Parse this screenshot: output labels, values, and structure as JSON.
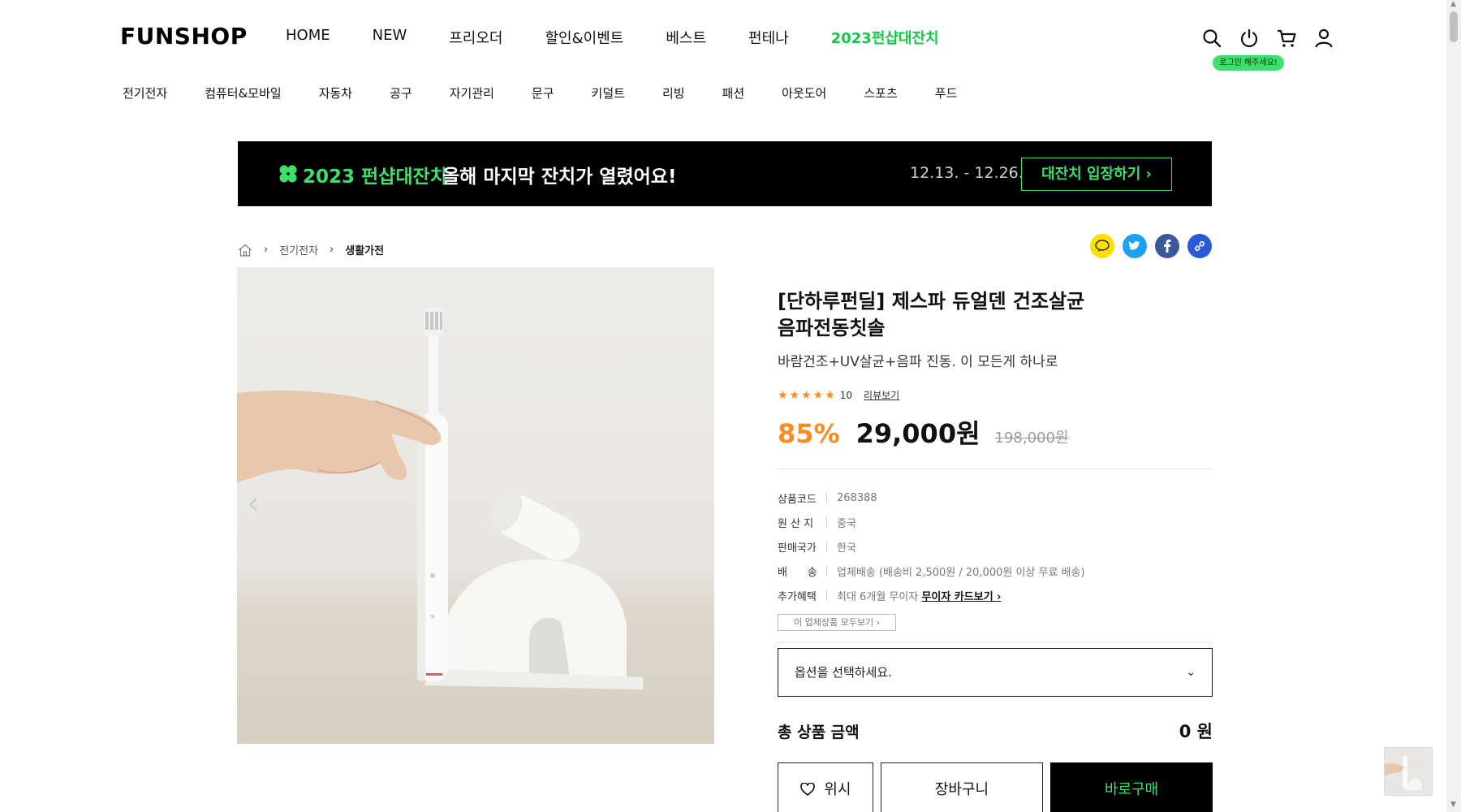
{
  "header": {
    "logo": "FUNSHOP",
    "nav": [
      "HOME",
      "NEW",
      "프리오더",
      "할인&이벤트",
      "베스트",
      "펀테나",
      "2023펀샵대잔치"
    ],
    "login_tip": "로그인 해주세요!",
    "icons": [
      "search-icon",
      "power-icon",
      "cart-icon",
      "user-icon"
    ],
    "accent_color": "#3ee06c"
  },
  "categories": [
    "전기전자",
    "컴퓨터&모바일",
    "자동차",
    "공구",
    "자기관리",
    "문구",
    "키덜트",
    "리빙",
    "패션",
    "아웃도어",
    "스포츠",
    "푸드"
  ],
  "banner": {
    "title": "2023 펀샵대잔치",
    "subtitle": "올해 마지막 잔치가 열렸어요!",
    "date": "12.13. - 12.26.",
    "button": "대잔치 입장하기 ›"
  },
  "breadcrumb": {
    "level1": "전기전자",
    "level2": "생활가전"
  },
  "share": [
    "talk-icon",
    "twitter-icon",
    "facebook-icon",
    "link-icon"
  ],
  "product": {
    "title_line1": "[단하루펀딜] 제스파 듀얼덴 건조살균",
    "title_line2": "음파전동칫솔",
    "subtitle": "바람건조+UV살균+음파 진동. 이 모든게 하나로",
    "rating_stars": 5,
    "review_count": "10",
    "review_link": "리뷰보기",
    "discount": "85%",
    "price": "29,000원",
    "original_price": "198,000원",
    "specs": [
      {
        "key": "상품코드",
        "value": "268388"
      },
      {
        "key": "원 산 지",
        "value": "중국"
      },
      {
        "key": "판매국가",
        "value": "한국"
      },
      {
        "key": "배      송",
        "value": "업체배송 (배송비 2,500원 / 20,000원 이상 무료 배송)"
      },
      {
        "key": "추가혜택",
        "value": "최대 6개월 무이자",
        "link": "무이자 카드보기 ›"
      }
    ],
    "seller_button": "이 업체상품 모두보기 ›",
    "option_placeholder": "옵션을 선택하세요.",
    "total_label": "총 상품 금액",
    "total_value": "0 원",
    "wish_label": "위시",
    "cart_label": "장바구니",
    "buy_label": "바로구매"
  }
}
